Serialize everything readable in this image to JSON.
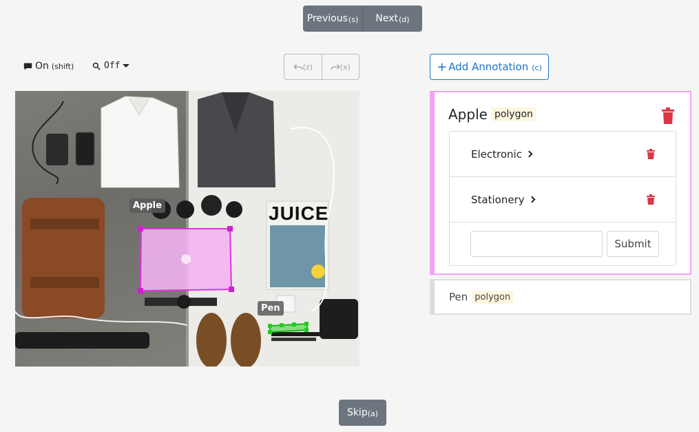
{
  "nav": {
    "previous_label": "Previous",
    "previous_key": "(s)",
    "next_label": "Next",
    "next_key": "(d)"
  },
  "toolbar": {
    "comment_label": "On",
    "comment_key": "(shift)",
    "zoom_label": "Off",
    "undo_key": "(z)",
    "redo_key": "(x)"
  },
  "canvas": {
    "labels": [
      {
        "text": "Apple"
      },
      {
        "text": "Pen"
      }
    ],
    "magazine_title": "JUICE"
  },
  "annotations": {
    "add_label": "Add Annotation",
    "add_key": "(c)",
    "items": [
      {
        "name": "Apple",
        "type": "polygon",
        "categories": [
          "Electronic",
          "Stationery"
        ],
        "input_value": "",
        "submit_label": "Submit"
      },
      {
        "name": "Pen",
        "type": "polygon"
      }
    ]
  },
  "footer": {
    "skip_label": "Skip",
    "skip_key": "(a)"
  },
  "colors": {
    "primary": "#1a73c8",
    "secondary_button": "#6c757d",
    "apple_highlight": "#f2a3f2",
    "pen_highlight": "#22cc22",
    "danger": "#dc3545",
    "tag_background": "#fdf6df"
  }
}
